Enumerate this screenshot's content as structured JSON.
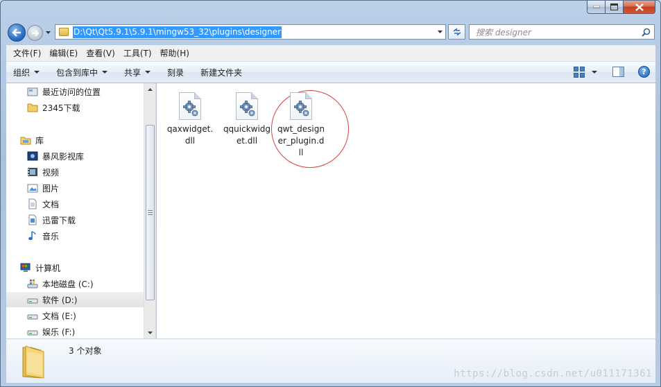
{
  "window": {
    "caption_buttons": [
      "minimize",
      "maximize",
      "close"
    ]
  },
  "address_bar": {
    "path": "D:\\Qt\\Qt5.9.1\\5.9.1\\mingw53_32\\plugins\\designer"
  },
  "search": {
    "placeholder": "搜索 designer"
  },
  "menu": {
    "items": [
      "文件(F)",
      "编辑(E)",
      "查看(V)",
      "工具(T)",
      "帮助(H)"
    ]
  },
  "toolbar": {
    "organize": "组织",
    "include_in_library": "包含到库中",
    "share": "共享",
    "burn": "刻录",
    "new_folder": "新建文件夹"
  },
  "nav_pane": {
    "items": [
      {
        "label": "最近访问的位置",
        "icon": "recent-places-icon",
        "indent": 1
      },
      {
        "label": "2345下载",
        "icon": "folder-icon",
        "indent": 1
      },
      {
        "label": "库",
        "icon": "library-icon",
        "indent": 0
      },
      {
        "label": "暴风影视库",
        "icon": "media-library-icon",
        "indent": 1
      },
      {
        "label": "视频",
        "icon": "video-icon",
        "indent": 1
      },
      {
        "label": "图片",
        "icon": "pictures-icon",
        "indent": 1
      },
      {
        "label": "文档",
        "icon": "documents-icon",
        "indent": 1
      },
      {
        "label": "迅雷下载",
        "icon": "download-icon",
        "indent": 1
      },
      {
        "label": "音乐",
        "icon": "music-icon",
        "indent": 1
      },
      {
        "label": "计算机",
        "icon": "computer-icon",
        "indent": 0
      },
      {
        "label": "本地磁盘 (C:)",
        "icon": "system-drive-icon",
        "indent": 1
      },
      {
        "label": "软件 (D:)",
        "icon": "drive-icon",
        "indent": 1,
        "selected": true
      },
      {
        "label": "文档 (E:)",
        "icon": "drive-icon",
        "indent": 1
      },
      {
        "label": "娱乐 (F:)",
        "icon": "drive-icon",
        "indent": 1
      }
    ]
  },
  "files": [
    {
      "name": "qaxwidget.dll",
      "icon": "dll-gear-icon"
    },
    {
      "name": "qquickwidget.dll",
      "icon": "dll-gear-icon"
    },
    {
      "name": "qwt_designer_plugin.dll",
      "icon": "dll-gear-icon",
      "circled": true
    }
  ],
  "details": {
    "count_text": "3 个对象"
  },
  "watermark": "https://blog.csdn.net/u011171361",
  "colors": {
    "selection": "#3399ff",
    "annotation_circle": "#d84040"
  }
}
